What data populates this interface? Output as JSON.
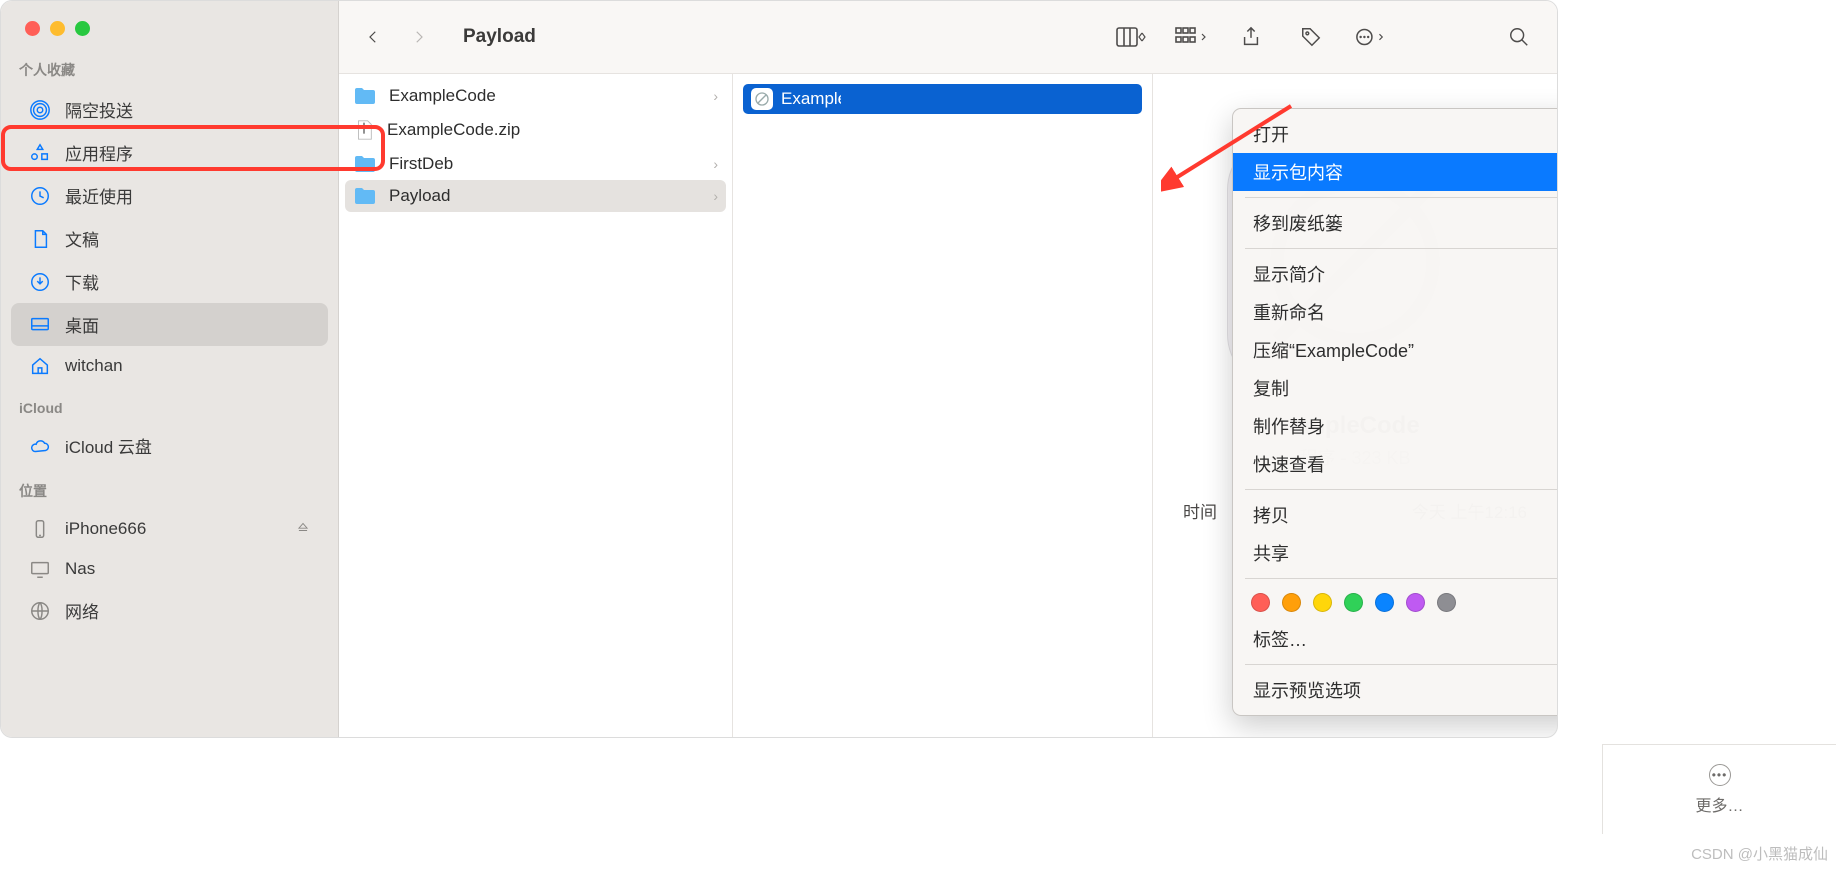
{
  "window": {
    "title": "Payload"
  },
  "traffic": {
    "colors": [
      "#ff5f57",
      "#febc2e",
      "#28c840"
    ]
  },
  "sidebar": {
    "sections": {
      "favorites": "个人收藏",
      "icloud": "iCloud",
      "locations": "位置"
    },
    "items": [
      {
        "icon": "airdrop",
        "label": "隔空投送"
      },
      {
        "icon": "apps",
        "label": "应用程序"
      },
      {
        "icon": "recents",
        "label": "最近使用"
      },
      {
        "icon": "documents",
        "label": "文稿"
      },
      {
        "icon": "downloads",
        "label": "下载"
      },
      {
        "icon": "desktop",
        "label": "桌面",
        "selected": true
      },
      {
        "icon": "home",
        "label": "witchan"
      }
    ],
    "icloud_items": [
      {
        "icon": "cloud",
        "label": "iCloud 云盘"
      }
    ],
    "location_items": [
      {
        "icon": "phone",
        "label": "iPhone666",
        "eject": true
      },
      {
        "icon": "display",
        "label": "Nas"
      },
      {
        "icon": "globe",
        "label": "网络"
      }
    ]
  },
  "column1": {
    "items": [
      {
        "type": "folder",
        "label": "ExampleCode",
        "chevron": true
      },
      {
        "type": "zip",
        "label": "ExampleCode.zip"
      },
      {
        "type": "folder",
        "label": "FirstDeb",
        "chevron": true
      },
      {
        "type": "folder",
        "label": "Payload",
        "chevron": true,
        "selected": true,
        "highlighted": true
      }
    ]
  },
  "column2": {
    "selected_item": "ExampleCode"
  },
  "context_menu": {
    "groups": [
      [
        "打开",
        "显示包内容"
      ],
      [
        "移到废纸篓"
      ],
      [
        "显示简介",
        "重新命名",
        "压缩“ExampleCode”",
        "复制",
        "制作替身",
        "快速查看"
      ],
      [
        "拷贝",
        "共享"
      ]
    ],
    "hovered": "显示包内容",
    "share_has_submenu": true,
    "tags_label": "标签…",
    "tags": [
      "#ff5f57",
      "#ff9f0a",
      "#ffd60a",
      "#30d158",
      "#0a84ff",
      "#bf5af2",
      "#8e8e93"
    ],
    "last": "显示预览选项"
  },
  "preview": {
    "title_prefix": "ampleCode",
    "subtitle": "程序 - 323 KB",
    "row1": {
      "label": "时间",
      "value": "今天 上午12:16"
    }
  },
  "more": {
    "label": "更多…"
  },
  "watermark": "CSDN @小黑猫成仙"
}
